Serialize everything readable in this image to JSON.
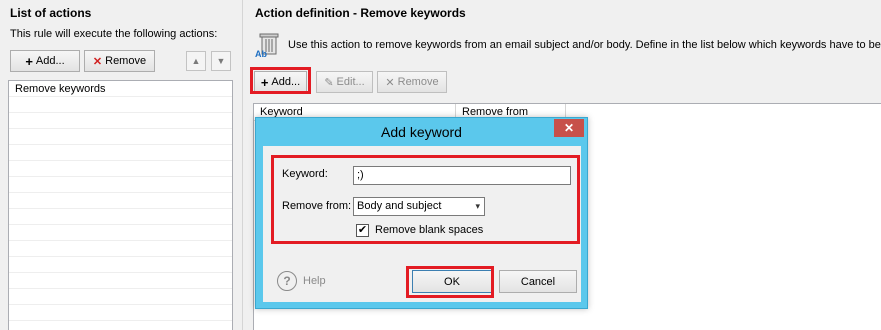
{
  "left_pane": {
    "title": "List of actions",
    "subtitle": "This rule will execute the following actions:",
    "add_label": "Add...",
    "remove_label": "Remove",
    "items": [
      "Remove keywords"
    ]
  },
  "right_pane": {
    "title": "Action definition - Remove keywords",
    "description": "Use this action to remove keywords from an email subject and/or body. Define in the list below which keywords have to be",
    "add_label": "Add...",
    "edit_label": "Edit...",
    "remove_label": "Remove",
    "columns": [
      "Keyword",
      "Remove from"
    ]
  },
  "dialog": {
    "title": "Add keyword",
    "close_glyph": "✕",
    "keyword_label": "Keyword:",
    "keyword_value": ";)",
    "remove_from_label": "Remove from:",
    "remove_from_value": "Body and subject",
    "blank_spaces_label": "Remove blank spaces",
    "blank_spaces_checked": true,
    "help_label": "Help",
    "ok_label": "OK",
    "cancel_label": "Cancel"
  },
  "icons": {
    "plus": "+",
    "x": "✕",
    "pencil": "✎",
    "check": "✔",
    "up": "▲",
    "down": "▼",
    "dropdown": "▾",
    "help": "?"
  },
  "colors": {
    "highlight": "#e31b23",
    "dialog_frame": "#5bc8ec",
    "close": "#c7504a",
    "remove_x": "#d02020"
  }
}
